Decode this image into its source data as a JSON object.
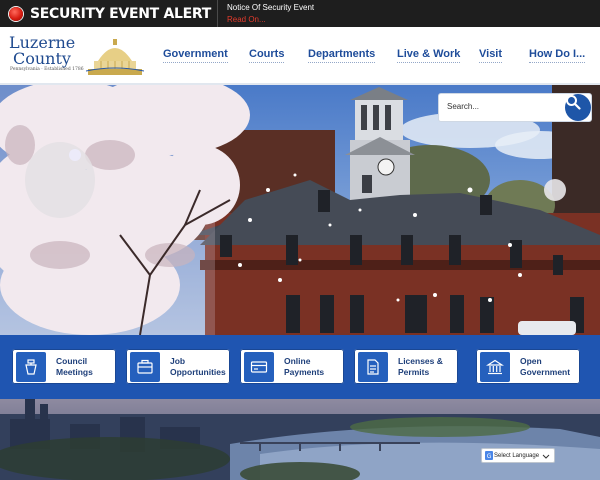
{
  "alert": {
    "title": "SECURITY EVENT ALERT",
    "notice": "Notice Of Security Event",
    "read_more": "Read On..."
  },
  "logo": {
    "line1": "Luzerne",
    "line2": "County",
    "tagline": "Pennsylvania · Established 1786"
  },
  "nav": [
    {
      "label": "Government"
    },
    {
      "label": "Courts"
    },
    {
      "label": "Departments"
    },
    {
      "label": "Live & Work"
    },
    {
      "label": "Visit"
    },
    {
      "label": "How Do I..."
    }
  ],
  "search": {
    "placeholder": "Search..."
  },
  "quick_links": [
    {
      "label_line1": "Council",
      "label_line2": "Meetings",
      "icon": "podium-icon"
    },
    {
      "label_line1": "Job",
      "label_line2": "Opportunities",
      "icon": "briefcase-icon"
    },
    {
      "label_line1": "Online",
      "label_line2": "Payments",
      "icon": "credit-card-icon"
    },
    {
      "label_line1": "Licenses &",
      "label_line2": "Permits",
      "icon": "document-icon"
    },
    {
      "label_line1": "Open",
      "label_line2": "Government",
      "icon": "government-building-icon"
    }
  ],
  "translate": {
    "label": "Select Language"
  },
  "colors": {
    "alert_bg": "#1e1e1e",
    "alert_red": "#e33a2c",
    "nav_blue": "#1e4c9a",
    "band_blue": "#1f55b1",
    "search_button": "#1e56a8"
  }
}
